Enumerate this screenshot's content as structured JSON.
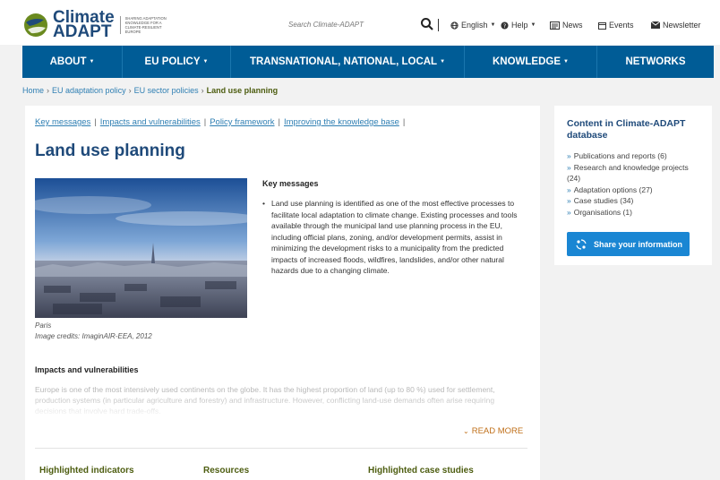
{
  "header": {
    "logo_line1": "Climate",
    "logo_line2": "ADAPT",
    "logo_tagline": "Sharing adaptation knowledge for a climate-resilient Europe",
    "search_placeholder": "Search Climate-ADAPT",
    "language": "English",
    "help": "Help",
    "news": "News",
    "events": "Events",
    "newsletter": "Newsletter"
  },
  "nav": {
    "items": [
      {
        "label": "ABOUT"
      },
      {
        "label": "EU POLICY"
      },
      {
        "label": "TRANSNATIONAL, NATIONAL, LOCAL"
      },
      {
        "label": "KNOWLEDGE"
      },
      {
        "label": "NETWORKS"
      }
    ]
  },
  "breadcrumb": {
    "items": [
      "Home",
      "EU adaptation policy",
      "EU sector policies"
    ],
    "current": "Land use planning"
  },
  "main": {
    "tabs": [
      "Key messages",
      "Impacts and vulnerabilities",
      "Policy framework",
      "Improving the knowledge base"
    ],
    "title": "Land use planning",
    "caption_line1": "Paris",
    "caption_line2": "Image credits: ImaginAIR-EEA, 2012",
    "key_messages_heading": "Key messages",
    "key_messages_body": "Land use planning is identified as one of the most effective processes to facilitate local adaptation to climate change. Existing processes and tools available through the municipal land use planning process in the EU, including official plans, zoning, and/or development permits, assist in minimizing the development risks to a municipality from the predicted impacts of increased floods, wildfires, landslides, and/or other natural hazards due to a changing climate.",
    "impacts_heading": "Impacts and vulnerabilities",
    "impacts_body": "Europe is one of the most intensively used continents on the globe. It has the highest proportion of land (up to 80 %) used for settlement, production systems (in particular agriculture and forestry) and infrastructure. However, conflicting land-use demands often arise requiring decisions that involve hard trade-offs.",
    "read_more": "READ MORE",
    "bottom_headings": [
      "Highlighted indicators",
      "Resources",
      "Highlighted case studies"
    ]
  },
  "sidebar": {
    "heading": "Content in Climate-ADAPT database",
    "links": [
      "Publications and reports (6)",
      "Research and knowledge projects (24)",
      "Adaptation options (27)",
      "Case studies (34)",
      "Organisations (1)"
    ],
    "share_label": "Share your information"
  }
}
